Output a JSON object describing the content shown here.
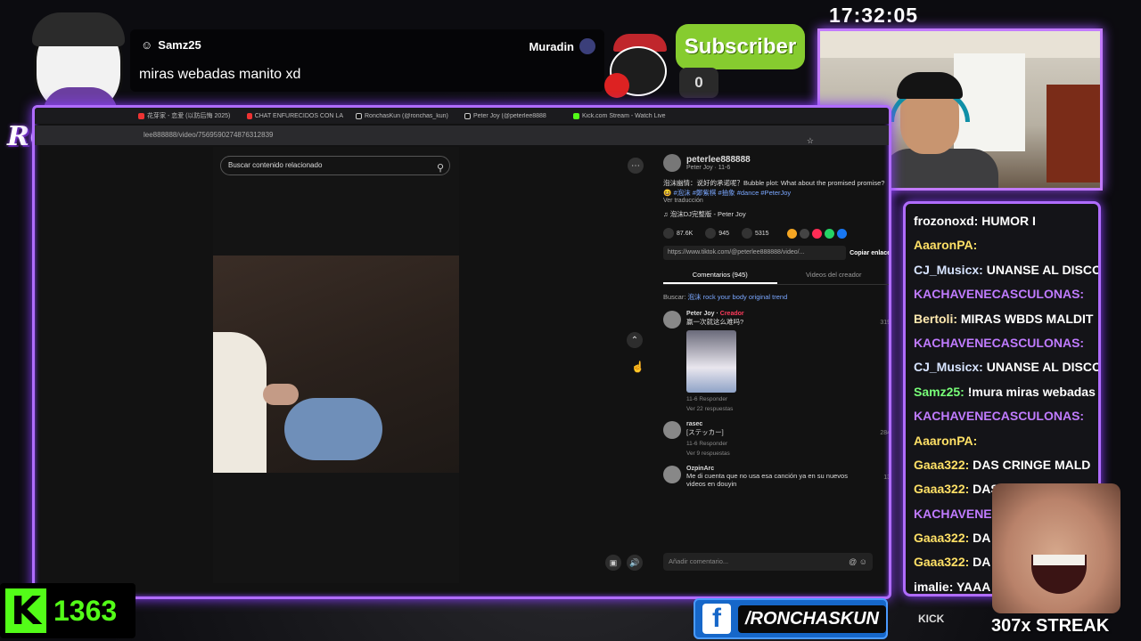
{
  "overlay": {
    "logo_text": "RONCHAS",
    "clock": "17:32:05",
    "subscriber_label": "Subscriber",
    "subscriber_count": "0",
    "kick_count": "1363",
    "facebook_handle": "/RONCHASKUN",
    "socials_text": "KICK",
    "streak": "307x STREAK",
    "accent_color": "#b06cff",
    "kick_color": "#53fc18"
  },
  "alert": {
    "username": "Samz25",
    "message": "miras webadas manito xd",
    "channel": "Muradin"
  },
  "browser": {
    "tabs": [
      {
        "label": "花芽家 - 恋爱 (以防后悔 2025)"
      },
      {
        "label": "CHAT ENFURECIDOS CON LA"
      },
      {
        "label": "RonchasKun (@ronchas_kun)"
      },
      {
        "label": "Peter Joy (@peterlee8888"
      },
      {
        "label": "Kick.com Stream - Watch Live"
      }
    ],
    "url": "lee888888/video/7569590274876312839"
  },
  "tiktok": {
    "search_placeholder": "Buscar contenido relacionado",
    "author_handle": "peterlee888888",
    "author_sub": "Peter Joy · 11-6",
    "caption": "泡沫幽情：说好的承诺呢？Bubble plot: What about the promised promise? 😆",
    "hashtags": "#泡沫 #鄭紫棋 #抽象 #dance #PeterJoy",
    "translate": "Ver traducción",
    "music": "泡沫DJ完整版 - Peter Joy",
    "likes": "87.6K",
    "comments_count": "945",
    "saves": "5315",
    "link": "https://www.tiktok.com/@peterlee888888/video/...",
    "copy_label": "Copiar enlace",
    "tab_comments": "Comentarios (945)",
    "tab_videos": "Videos del creador",
    "search_query_prefix": "Buscar:",
    "search_query": "泡沫 rock your body original trend",
    "comments": [
      {
        "name": "Peter Joy",
        "tag": "Creador",
        "text": "赢一次就这么难吗?",
        "meta": "11-6    Responder",
        "replies": "Ver 22 respuestas",
        "count": "319"
      },
      {
        "name": "rasec",
        "tag": "",
        "text": "[ステッカー]",
        "meta": "11-6    Responder",
        "replies": "Ver 9 respuestas",
        "count": "284"
      },
      {
        "name": "OzpinArc",
        "tag": "",
        "text": "Me di cuenta que no usa esa canción ya en su nuevos videos en douyin",
        "meta": "",
        "replies": "",
        "count": "13"
      }
    ],
    "add_comment": "Añadir comentario..."
  },
  "chat": [
    {
      "user": "frozonoxd:",
      "text": "HUMOR I",
      "color": "#ffffff"
    },
    {
      "user": "AaaronPA:",
      "text": "",
      "color": "#ffe066"
    },
    {
      "user": "CJ_Musicx:",
      "text": "UNANSE AL DISCO",
      "color": "#d7e4ff"
    },
    {
      "user": "KACHAVENECASCULONAS:",
      "text": "",
      "color": "#c07bff"
    },
    {
      "user": "Bertoli:",
      "text": "MIRAS WBDS MALDIT",
      "color": "#ffe9b0"
    },
    {
      "user": "KACHAVENECASCULONAS:",
      "text": "",
      "color": "#c07bff"
    },
    {
      "user": "CJ_Musicx:",
      "text": "UNANSE AL DISCO",
      "color": "#d7e4ff"
    },
    {
      "user": "Samz25:",
      "text": "!mura miras webadas",
      "color": "#78ff78"
    },
    {
      "user": "KACHAVENECASCULONAS:",
      "text": "",
      "color": "#c07bff"
    },
    {
      "user": "AaaronPA:",
      "text": "",
      "color": "#ffe066"
    },
    {
      "user": "Gaaa322:",
      "text": "DAS CRINGE MALD",
      "color": "#ffe066"
    },
    {
      "user": "Gaaa322:",
      "text": "DAS CRINGE MALD",
      "color": "#ffe066"
    },
    {
      "user": "KACHAVENE",
      "text": "",
      "color": "#c07bff"
    },
    {
      "user": "Gaaa322:",
      "text": "DA",
      "color": "#ffe066"
    },
    {
      "user": "Gaaa322:",
      "text": "DA",
      "color": "#ffe066"
    },
    {
      "user": "imalie:",
      "text": "YAAA",
      "color": "#ffffff"
    }
  ]
}
